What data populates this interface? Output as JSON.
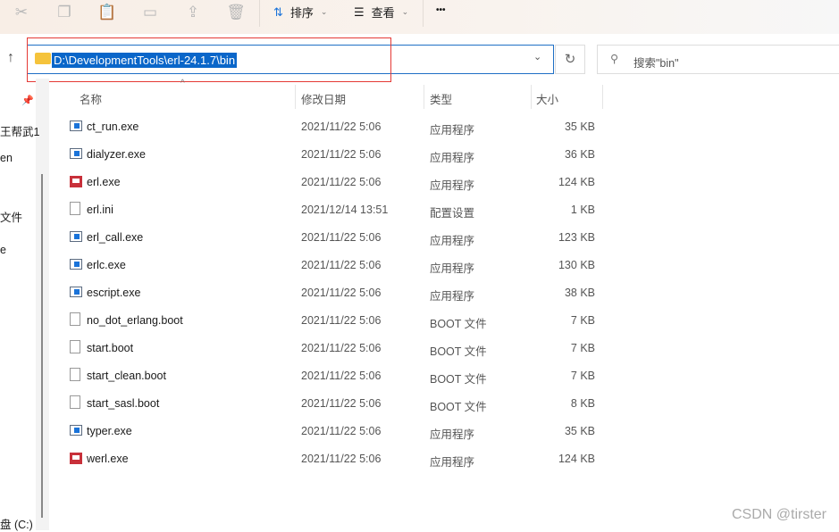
{
  "toolbar": {
    "sort_label": "排序",
    "view_label": "查看",
    "more_label": "•••"
  },
  "address": {
    "path": "D:\\DevelopmentTools\\erl-24.1.7\\bin"
  },
  "search": {
    "placeholder": "搜索\"bin\""
  },
  "sidebar": {
    "items": [
      "王帮武1",
      "en",
      "文件",
      "e",
      "盘 (C:)"
    ]
  },
  "columns": {
    "name": "名称",
    "date": "修改日期",
    "type": "类型",
    "size": "大小"
  },
  "files": [
    {
      "name": "ct_run.exe",
      "date": "2021/11/22 5:06",
      "type": "应用程序",
      "size": "35 KB",
      "icon": "exe"
    },
    {
      "name": "dialyzer.exe",
      "date": "2021/11/22 5:06",
      "type": "应用程序",
      "size": "36 KB",
      "icon": "exe"
    },
    {
      "name": "erl.exe",
      "date": "2021/11/22 5:06",
      "type": "应用程序",
      "size": "124 KB",
      "icon": "erl"
    },
    {
      "name": "erl.ini",
      "date": "2021/12/14 13:51",
      "type": "配置设置",
      "size": "1 KB",
      "icon": "ini"
    },
    {
      "name": "erl_call.exe",
      "date": "2021/11/22 5:06",
      "type": "应用程序",
      "size": "123 KB",
      "icon": "exe"
    },
    {
      "name": "erlc.exe",
      "date": "2021/11/22 5:06",
      "type": "应用程序",
      "size": "130 KB",
      "icon": "exe"
    },
    {
      "name": "escript.exe",
      "date": "2021/11/22 5:06",
      "type": "应用程序",
      "size": "38 KB",
      "icon": "exe"
    },
    {
      "name": "no_dot_erlang.boot",
      "date": "2021/11/22 5:06",
      "type": "BOOT 文件",
      "size": "7 KB",
      "icon": "boot"
    },
    {
      "name": "start.boot",
      "date": "2021/11/22 5:06",
      "type": "BOOT 文件",
      "size": "7 KB",
      "icon": "boot"
    },
    {
      "name": "start_clean.boot",
      "date": "2021/11/22 5:06",
      "type": "BOOT 文件",
      "size": "7 KB",
      "icon": "boot"
    },
    {
      "name": "start_sasl.boot",
      "date": "2021/11/22 5:06",
      "type": "BOOT 文件",
      "size": "8 KB",
      "icon": "boot"
    },
    {
      "name": "typer.exe",
      "date": "2021/11/22 5:06",
      "type": "应用程序",
      "size": "35 KB",
      "icon": "exe"
    },
    {
      "name": "werl.exe",
      "date": "2021/11/22 5:06",
      "type": "应用程序",
      "size": "124 KB",
      "icon": "erl"
    }
  ],
  "watermark": "CSDN @tirster"
}
